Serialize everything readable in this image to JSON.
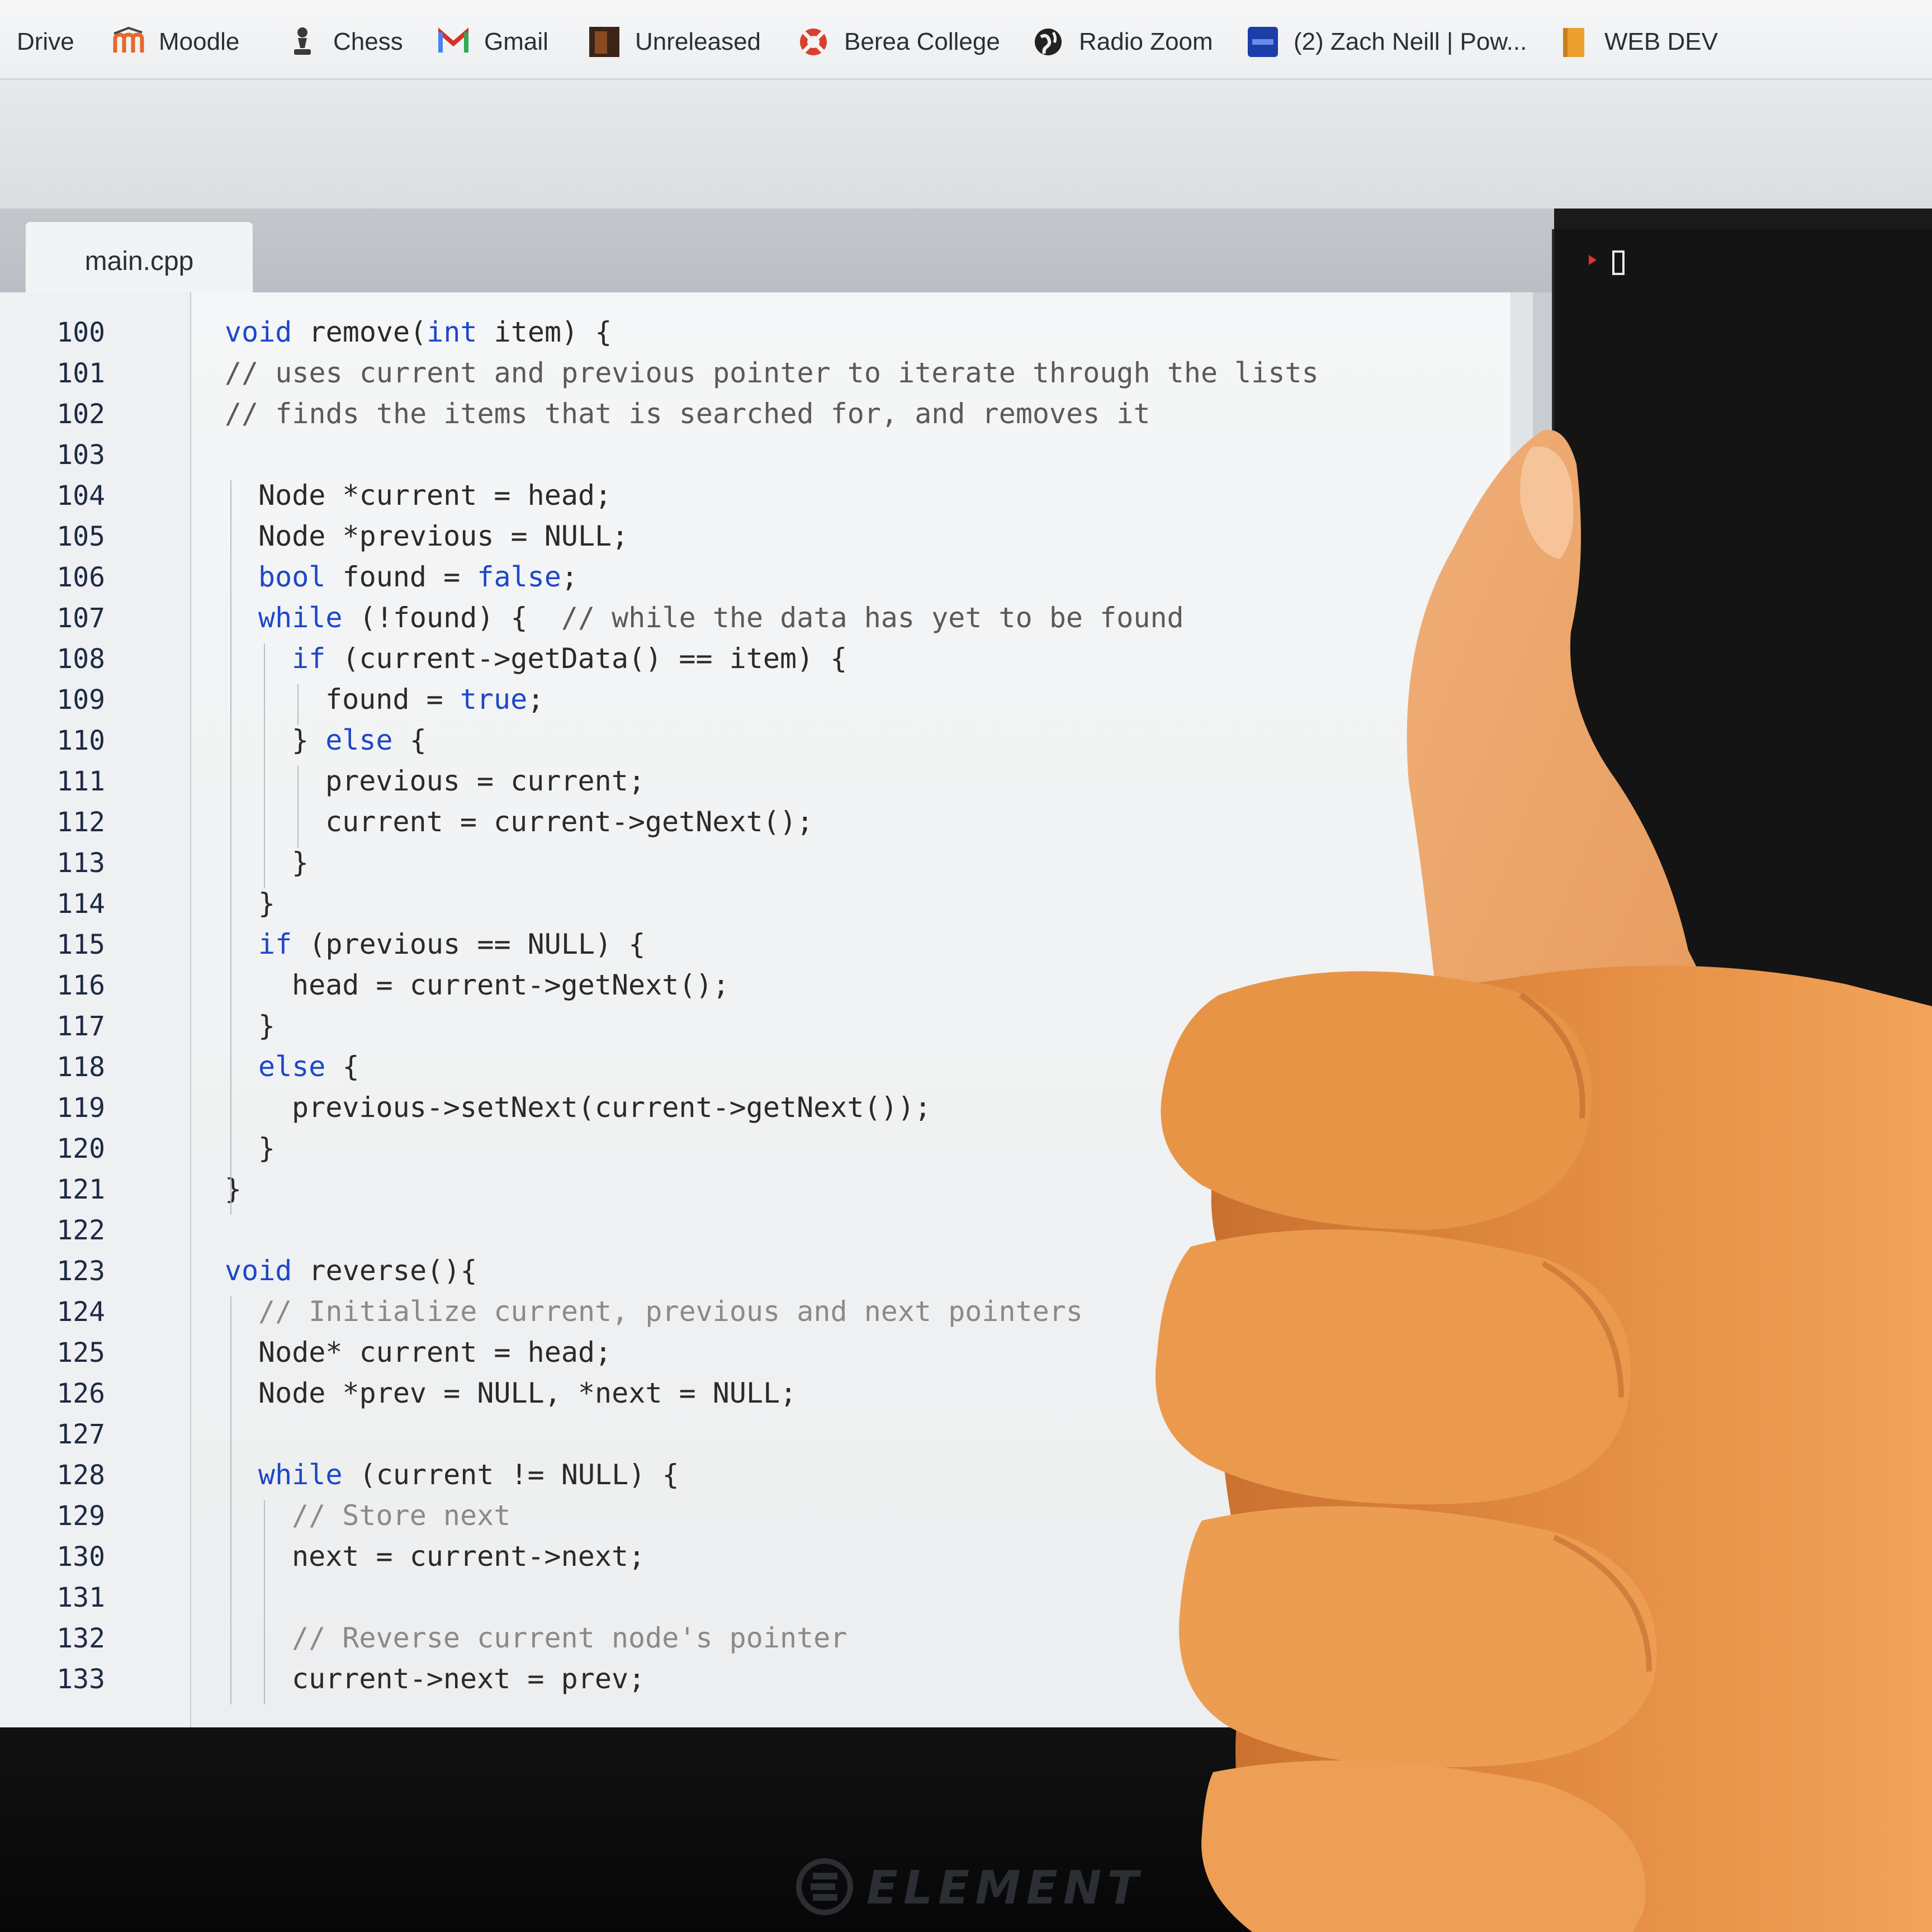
{
  "bookmarks_bar": {
    "items": [
      {
        "label": "Drive",
        "icon": "drive-icon"
      },
      {
        "label": "Moodle",
        "icon": "moodle-icon"
      },
      {
        "label": "Chess",
        "icon": "chess-pawn-icon"
      },
      {
        "label": "Gmail",
        "icon": "gmail-icon"
      },
      {
        "label": "Unreleased",
        "icon": "album-art-icon"
      },
      {
        "label": "Berea College",
        "icon": "lifebuoy-icon"
      },
      {
        "label": "Radio Zoom",
        "icon": "globe-icon"
      },
      {
        "label": "(2) Zach Neill | Pow...",
        "icon": "box-icon"
      },
      {
        "label": "WEB DEV",
        "icon": "folder-icon"
      }
    ]
  },
  "editor": {
    "tab": {
      "label": "main.cpp"
    },
    "lines": [
      {
        "num": "100",
        "segments": [
          {
            "t": "kw",
            "text": "void"
          },
          {
            "t": "n",
            "text": " remove("
          },
          {
            "t": "kw",
            "text": "int"
          },
          {
            "t": "n",
            "text": " item) {"
          }
        ]
      },
      {
        "num": "101",
        "segments": [
          {
            "t": "cm",
            "text": "// uses current and previous pointer to iterate through the lists"
          }
        ]
      },
      {
        "num": "102",
        "segments": [
          {
            "t": "cm",
            "text": "// finds the items that is searched for, and removes it"
          }
        ]
      },
      {
        "num": "103",
        "segments": []
      },
      {
        "num": "104",
        "segments": [
          {
            "t": "n",
            "text": "Node *current = head;"
          }
        ]
      },
      {
        "num": "105",
        "segments": [
          {
            "t": "n",
            "text": "Node *previous = NULL;"
          }
        ]
      },
      {
        "num": "106",
        "segments": [
          {
            "t": "kw",
            "text": "bool"
          },
          {
            "t": "n",
            "text": " found = "
          },
          {
            "t": "kw",
            "text": "false"
          },
          {
            "t": "n",
            "text": ";"
          }
        ]
      },
      {
        "num": "107",
        "segments": [
          {
            "t": "kw",
            "text": "while"
          },
          {
            "t": "n",
            "text": " (!found) {  "
          },
          {
            "t": "cm",
            "text": "// while the data has yet to be found"
          }
        ]
      },
      {
        "num": "108",
        "segments": [
          {
            "t": "kw",
            "text": "if"
          },
          {
            "t": "n",
            "text": " (current->getData() == item) {"
          }
        ]
      },
      {
        "num": "109",
        "segments": [
          {
            "t": "n",
            "text": "found = "
          },
          {
            "t": "kw",
            "text": "true"
          },
          {
            "t": "n",
            "text": ";"
          }
        ]
      },
      {
        "num": "110",
        "segments": [
          {
            "t": "n",
            "text": "} "
          },
          {
            "t": "kw",
            "text": "else"
          },
          {
            "t": "n",
            "text": " {"
          }
        ]
      },
      {
        "num": "111",
        "segments": [
          {
            "t": "n",
            "text": "previous = current;"
          }
        ]
      },
      {
        "num": "112",
        "segments": [
          {
            "t": "n",
            "text": "current = current->getNext();"
          }
        ]
      },
      {
        "num": "113",
        "segments": [
          {
            "t": "n",
            "text": "}"
          }
        ]
      },
      {
        "num": "114",
        "segments": [
          {
            "t": "n",
            "text": "}"
          }
        ]
      },
      {
        "num": "115",
        "segments": [
          {
            "t": "kw",
            "text": "if"
          },
          {
            "t": "n",
            "text": " (previous == NULL) {"
          }
        ]
      },
      {
        "num": "116",
        "segments": [
          {
            "t": "n",
            "text": "head = current->getNext();"
          }
        ]
      },
      {
        "num": "117",
        "segments": [
          {
            "t": "n",
            "text": "}"
          }
        ]
      },
      {
        "num": "118",
        "segments": [
          {
            "t": "kw",
            "text": "else"
          },
          {
            "t": "n",
            "text": " {"
          }
        ]
      },
      {
        "num": "119",
        "segments": [
          {
            "t": "n",
            "text": "previous->setNext(current->getNext());"
          }
        ]
      },
      {
        "num": "120",
        "segments": [
          {
            "t": "n",
            "text": "}"
          }
        ]
      },
      {
        "num": "121",
        "segments": [
          {
            "t": "n",
            "text": "}"
          }
        ]
      },
      {
        "num": "122",
        "segments": []
      },
      {
        "num": "123",
        "segments": [
          {
            "t": "kw",
            "text": "void"
          },
          {
            "t": "n",
            "text": " reverse(){"
          }
        ]
      },
      {
        "num": "124",
        "segments": [
          {
            "t": "cmf",
            "text": "// Initialize current, previous and next pointers"
          }
        ]
      },
      {
        "num": "125",
        "segments": [
          {
            "t": "n",
            "text": "Node* current = head;"
          }
        ]
      },
      {
        "num": "126",
        "segments": [
          {
            "t": "n",
            "text": "Node *prev = NULL, *next = NULL;"
          }
        ]
      },
      {
        "num": "127",
        "segments": []
      },
      {
        "num": "128",
        "segments": [
          {
            "t": "kw",
            "text": "while"
          },
          {
            "t": "n",
            "text": " (current != NULL) {"
          }
        ]
      },
      {
        "num": "129",
        "segments": [
          {
            "t": "cmf",
            "text": "// Store next"
          }
        ]
      },
      {
        "num": "130",
        "segments": [
          {
            "t": "n",
            "text": "next = current->next;"
          }
        ]
      },
      {
        "num": "131",
        "segments": []
      },
      {
        "num": "132",
        "segments": [
          {
            "t": "cmf",
            "text": "// Reverse current node's pointer"
          }
        ]
      },
      {
        "num": "133",
        "segments": [
          {
            "t": "n",
            "text": "current->next = prev;"
          }
        ]
      }
    ]
  },
  "monitor": {
    "brand": "ELEMENT"
  },
  "colors": {
    "keyword": "#1f47c8",
    "comment": "#5a5a5a",
    "comment_faded": "#8a8a8a",
    "code_text": "#2a2a2a",
    "line_number": "#1f2a44",
    "terminal_bg": "#141414",
    "terminal_prompt": "#e0322d",
    "skin": "#e08a3e"
  }
}
